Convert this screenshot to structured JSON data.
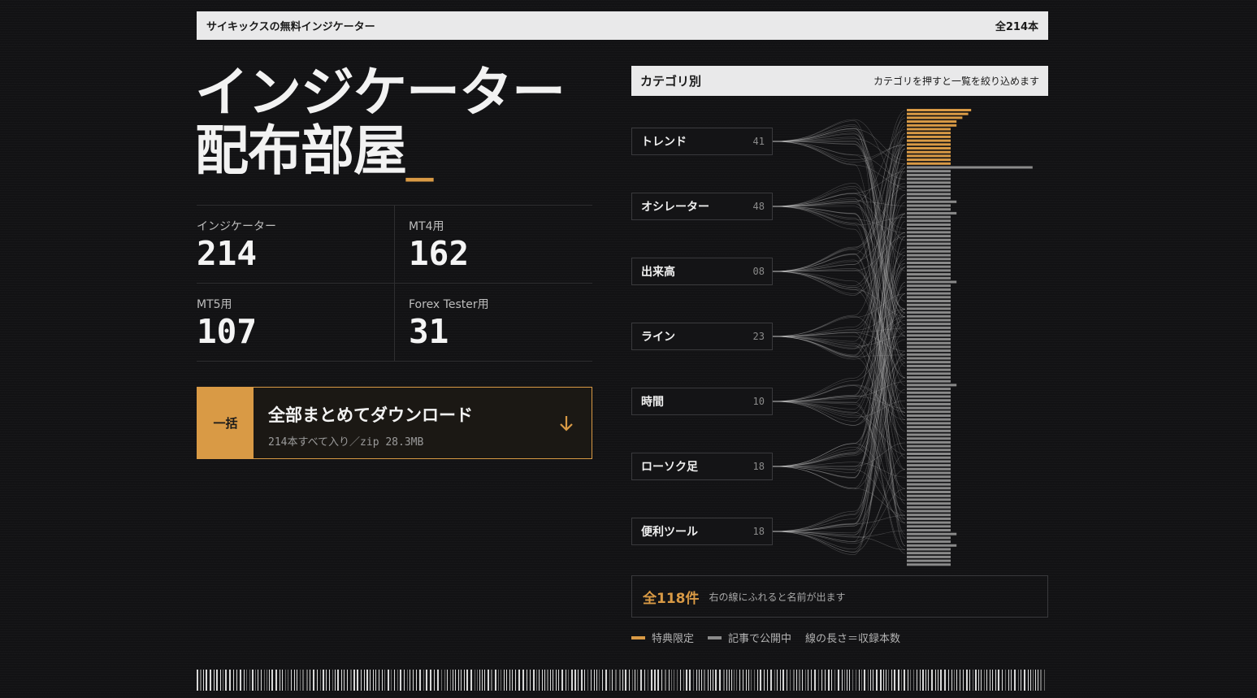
{
  "topbar": {
    "title": "サイキックスの無料インジケーター",
    "count": "全214本"
  },
  "hero": {
    "line1": "インジケーター",
    "line2": "配布部屋",
    "cursor": "_"
  },
  "stats": [
    {
      "label": "インジケーター",
      "value": "214"
    },
    {
      "label": "MT4用",
      "value": "162"
    },
    {
      "label": "MT5用",
      "value": "107"
    },
    {
      "label": "Forex Tester用",
      "value": "31"
    }
  ],
  "download": {
    "tag": "一括",
    "title": "全部まとめてダウンロード",
    "subtitle": "214本すべて入り／zip 28.3MB",
    "icon": "arrow-down-icon"
  },
  "categories": {
    "header_title": "カテゴリ別",
    "header_note": "カテゴリを押すと一覧を絞り込めます",
    "items": [
      {
        "name": "トレンド",
        "count": "41"
      },
      {
        "name": "オシレーター",
        "count": "48"
      },
      {
        "name": "出来高",
        "count": "08"
      },
      {
        "name": "ライン",
        "count": "23"
      },
      {
        "name": "時間",
        "count": "10"
      },
      {
        "name": "ローソク足",
        "count": "18"
      },
      {
        "name": "便利ツール",
        "count": "18"
      }
    ]
  },
  "summary": {
    "total": "全118件",
    "hint": "右の線にふれると名前が出ます"
  },
  "legend": {
    "items": [
      {
        "label": "特典限定",
        "color": "#d99a45"
      },
      {
        "label": "記事で公開中",
        "color": "#8a8a8a"
      }
    ],
    "note": "線の長さ＝収録本数"
  },
  "colors": {
    "accent": "#d99a45",
    "muted": "#8a8a8a",
    "background": "#121214"
  },
  "viz": {
    "items_total": 118,
    "highlighted_items": 15,
    "bar_lengths": [
      22,
      21,
      19,
      17,
      17,
      15,
      15,
      15,
      15,
      15,
      15,
      15,
      15,
      15,
      15,
      43,
      15,
      15,
      15,
      15,
      15,
      15,
      15,
      15,
      17,
      15,
      15,
      17,
      15,
      15,
      15,
      15,
      15,
      15,
      15,
      15,
      15,
      15,
      15,
      15,
      15,
      15,
      15,
      15,
      15,
      17,
      15,
      15,
      15,
      15,
      15,
      15,
      15,
      15,
      15,
      15,
      15,
      15,
      15,
      15,
      15,
      15,
      15,
      15,
      15,
      15,
      15,
      15,
      15,
      15,
      15,
      15,
      17,
      15,
      15,
      15,
      15,
      15,
      15,
      15,
      15,
      15,
      15,
      15,
      15,
      15,
      15,
      15,
      15,
      15,
      15,
      15,
      15,
      15,
      15,
      15,
      15,
      15,
      15,
      15,
      15,
      15,
      15,
      15,
      15,
      15,
      15,
      15,
      15,
      15,
      15,
      17,
      15,
      15,
      17,
      15,
      15,
      15,
      15,
      15
    ]
  }
}
